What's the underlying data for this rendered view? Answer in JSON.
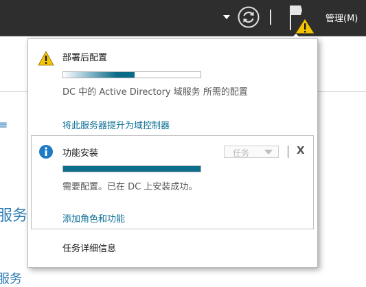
{
  "toolbar": {
    "manage_label": "管理(M)",
    "icons": [
      "caret-down-icon",
      "refresh-icon",
      "notification-flag-icon",
      "warning-icon"
    ]
  },
  "background_page": {
    "fragment_1": "≡",
    "fragment_2": "服务器",
    "fragment_3": "服务"
  },
  "notifications": {
    "tasks": [
      {
        "title": "部署后配置",
        "icon": "warning-icon",
        "progress": 0.52,
        "description": "DC 中的 Active Directory 域服务 所需的配置",
        "link": "将此服务器提升为域控制器"
      },
      {
        "title": "功能安装",
        "icon": "info-icon",
        "progress": 1.0,
        "description": "需要配置。已在 DC 上安装成功。",
        "link": "添加角色和功能",
        "tasks_dropdown": "任务",
        "close_label": "X"
      }
    ],
    "details_link": "任务详细信息"
  },
  "colors": {
    "toolbar_bg": "#2e2e2e",
    "link": "#0c6f95",
    "progress": "#0d6e8c",
    "warning": "#f5c400",
    "info": "#1e7bc6"
  }
}
